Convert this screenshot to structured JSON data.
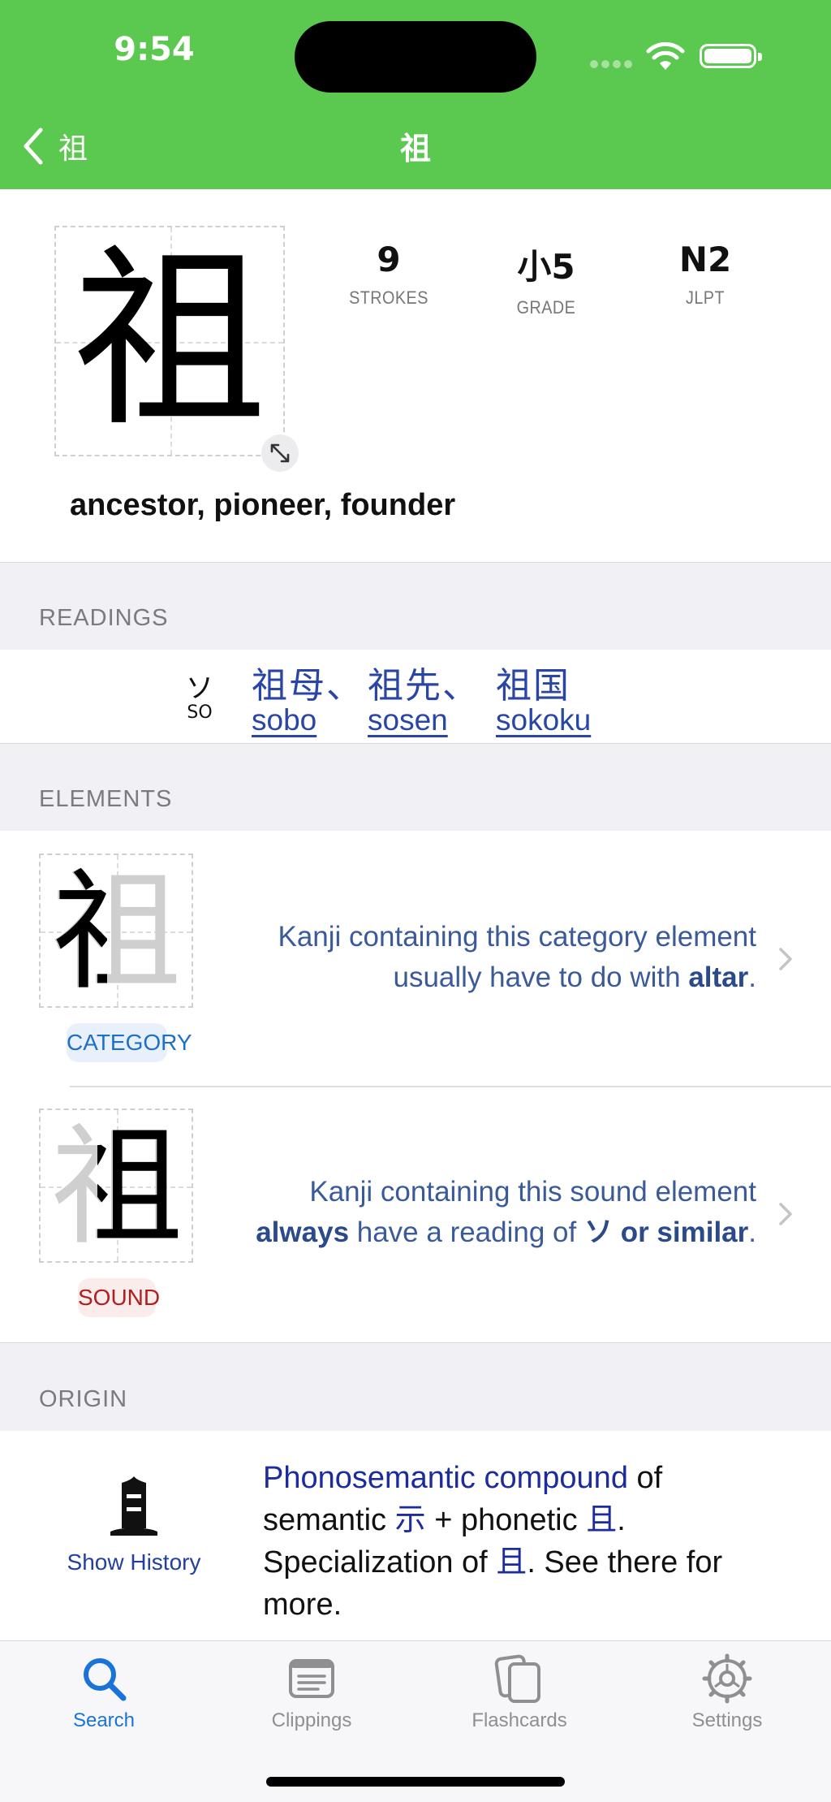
{
  "status": {
    "time": "9:54"
  },
  "colors": {
    "nav_bg": "#5bc850",
    "accent": "#1a73d9",
    "link": "#2946a6",
    "category": "#1e6fc8",
    "sound": "#b01f1f"
  },
  "nav": {
    "back_label": "祖",
    "title": "祖"
  },
  "kanji": {
    "character": "祖",
    "stats": [
      {
        "value": "9",
        "label": "STROKES"
      },
      {
        "value": "小5",
        "label": "GRADE"
      },
      {
        "value": "N2",
        "label": "JLPT"
      }
    ],
    "meaning": "ancestor, pioneer, founder"
  },
  "readings": {
    "header": "READINGS",
    "kana": "ソ",
    "romaji": "SO",
    "examples": [
      {
        "jp": "祖母、",
        "rom": "sobo"
      },
      {
        "jp": "祖先、",
        "rom": "sosen"
      },
      {
        "jp": "祖国",
        "rom": "sokoku"
      }
    ]
  },
  "elements": {
    "header": "ELEMENTS",
    "category": {
      "tag": "CATEGORY",
      "glyph": "祖",
      "desc_1": "Kanji containing this category element",
      "desc_2": "usually have to do with ",
      "desc_bold": "altar",
      "desc_end": "."
    },
    "sound": {
      "tag": "SOUND",
      "glyph": "祖",
      "desc_1": "Kanji containing this sound element",
      "desc_bold_1": "always",
      "desc_mid": " have a reading of ",
      "desc_bold_2": "ソ or similar",
      "desc_end": "."
    }
  },
  "origin": {
    "header": "ORIGIN",
    "show_history": "Show History",
    "link_compound": "Phonosemantic compound",
    "t_of": " of",
    "t_semantic": "semantic ",
    "link_semantic": "示",
    "t_plus": " + phonetic ",
    "link_phonetic": "且",
    "t_dot": ".",
    "t_special": "Specialization of ",
    "link_special": "且",
    "t_rest": ". See there for more."
  },
  "tabs": [
    {
      "label": "Search",
      "icon": "search-icon",
      "active": true
    },
    {
      "label": "Clippings",
      "icon": "clippings-icon",
      "active": false
    },
    {
      "label": "Flashcards",
      "icon": "flashcards-icon",
      "active": false
    },
    {
      "label": "Settings",
      "icon": "settings-icon",
      "active": false
    }
  ]
}
